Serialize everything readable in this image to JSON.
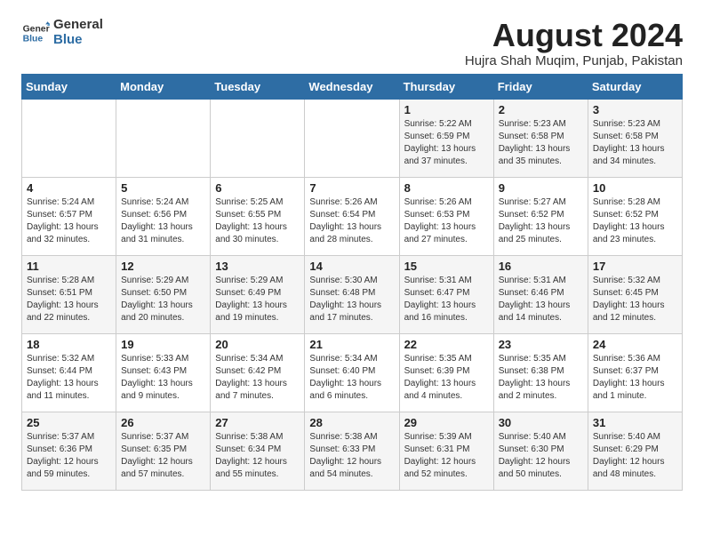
{
  "logo": {
    "general": "General",
    "blue": "Blue"
  },
  "title": {
    "month_year": "August 2024",
    "location": "Hujra Shah Muqim, Punjab, Pakistan"
  },
  "days_of_week": [
    "Sunday",
    "Monday",
    "Tuesday",
    "Wednesday",
    "Thursday",
    "Friday",
    "Saturday"
  ],
  "weeks": [
    [
      {
        "day": "",
        "info": ""
      },
      {
        "day": "",
        "info": ""
      },
      {
        "day": "",
        "info": ""
      },
      {
        "day": "",
        "info": ""
      },
      {
        "day": "1",
        "info": "Sunrise: 5:22 AM\nSunset: 6:59 PM\nDaylight: 13 hours\nand 37 minutes."
      },
      {
        "day": "2",
        "info": "Sunrise: 5:23 AM\nSunset: 6:58 PM\nDaylight: 13 hours\nand 35 minutes."
      },
      {
        "day": "3",
        "info": "Sunrise: 5:23 AM\nSunset: 6:58 PM\nDaylight: 13 hours\nand 34 minutes."
      }
    ],
    [
      {
        "day": "4",
        "info": "Sunrise: 5:24 AM\nSunset: 6:57 PM\nDaylight: 13 hours\nand 32 minutes."
      },
      {
        "day": "5",
        "info": "Sunrise: 5:24 AM\nSunset: 6:56 PM\nDaylight: 13 hours\nand 31 minutes."
      },
      {
        "day": "6",
        "info": "Sunrise: 5:25 AM\nSunset: 6:55 PM\nDaylight: 13 hours\nand 30 minutes."
      },
      {
        "day": "7",
        "info": "Sunrise: 5:26 AM\nSunset: 6:54 PM\nDaylight: 13 hours\nand 28 minutes."
      },
      {
        "day": "8",
        "info": "Sunrise: 5:26 AM\nSunset: 6:53 PM\nDaylight: 13 hours\nand 27 minutes."
      },
      {
        "day": "9",
        "info": "Sunrise: 5:27 AM\nSunset: 6:52 PM\nDaylight: 13 hours\nand 25 minutes."
      },
      {
        "day": "10",
        "info": "Sunrise: 5:28 AM\nSunset: 6:52 PM\nDaylight: 13 hours\nand 23 minutes."
      }
    ],
    [
      {
        "day": "11",
        "info": "Sunrise: 5:28 AM\nSunset: 6:51 PM\nDaylight: 13 hours\nand 22 minutes."
      },
      {
        "day": "12",
        "info": "Sunrise: 5:29 AM\nSunset: 6:50 PM\nDaylight: 13 hours\nand 20 minutes."
      },
      {
        "day": "13",
        "info": "Sunrise: 5:29 AM\nSunset: 6:49 PM\nDaylight: 13 hours\nand 19 minutes."
      },
      {
        "day": "14",
        "info": "Sunrise: 5:30 AM\nSunset: 6:48 PM\nDaylight: 13 hours\nand 17 minutes."
      },
      {
        "day": "15",
        "info": "Sunrise: 5:31 AM\nSunset: 6:47 PM\nDaylight: 13 hours\nand 16 minutes."
      },
      {
        "day": "16",
        "info": "Sunrise: 5:31 AM\nSunset: 6:46 PM\nDaylight: 13 hours\nand 14 minutes."
      },
      {
        "day": "17",
        "info": "Sunrise: 5:32 AM\nSunset: 6:45 PM\nDaylight: 13 hours\nand 12 minutes."
      }
    ],
    [
      {
        "day": "18",
        "info": "Sunrise: 5:32 AM\nSunset: 6:44 PM\nDaylight: 13 hours\nand 11 minutes."
      },
      {
        "day": "19",
        "info": "Sunrise: 5:33 AM\nSunset: 6:43 PM\nDaylight: 13 hours\nand 9 minutes."
      },
      {
        "day": "20",
        "info": "Sunrise: 5:34 AM\nSunset: 6:42 PM\nDaylight: 13 hours\nand 7 minutes."
      },
      {
        "day": "21",
        "info": "Sunrise: 5:34 AM\nSunset: 6:40 PM\nDaylight: 13 hours\nand 6 minutes."
      },
      {
        "day": "22",
        "info": "Sunrise: 5:35 AM\nSunset: 6:39 PM\nDaylight: 13 hours\nand 4 minutes."
      },
      {
        "day": "23",
        "info": "Sunrise: 5:35 AM\nSunset: 6:38 PM\nDaylight: 13 hours\nand 2 minutes."
      },
      {
        "day": "24",
        "info": "Sunrise: 5:36 AM\nSunset: 6:37 PM\nDaylight: 13 hours\nand 1 minute."
      }
    ],
    [
      {
        "day": "25",
        "info": "Sunrise: 5:37 AM\nSunset: 6:36 PM\nDaylight: 12 hours\nand 59 minutes."
      },
      {
        "day": "26",
        "info": "Sunrise: 5:37 AM\nSunset: 6:35 PM\nDaylight: 12 hours\nand 57 minutes."
      },
      {
        "day": "27",
        "info": "Sunrise: 5:38 AM\nSunset: 6:34 PM\nDaylight: 12 hours\nand 55 minutes."
      },
      {
        "day": "28",
        "info": "Sunrise: 5:38 AM\nSunset: 6:33 PM\nDaylight: 12 hours\nand 54 minutes."
      },
      {
        "day": "29",
        "info": "Sunrise: 5:39 AM\nSunset: 6:31 PM\nDaylight: 12 hours\nand 52 minutes."
      },
      {
        "day": "30",
        "info": "Sunrise: 5:40 AM\nSunset: 6:30 PM\nDaylight: 12 hours\nand 50 minutes."
      },
      {
        "day": "31",
        "info": "Sunrise: 5:40 AM\nSunset: 6:29 PM\nDaylight: 12 hours\nand 48 minutes."
      }
    ]
  ]
}
